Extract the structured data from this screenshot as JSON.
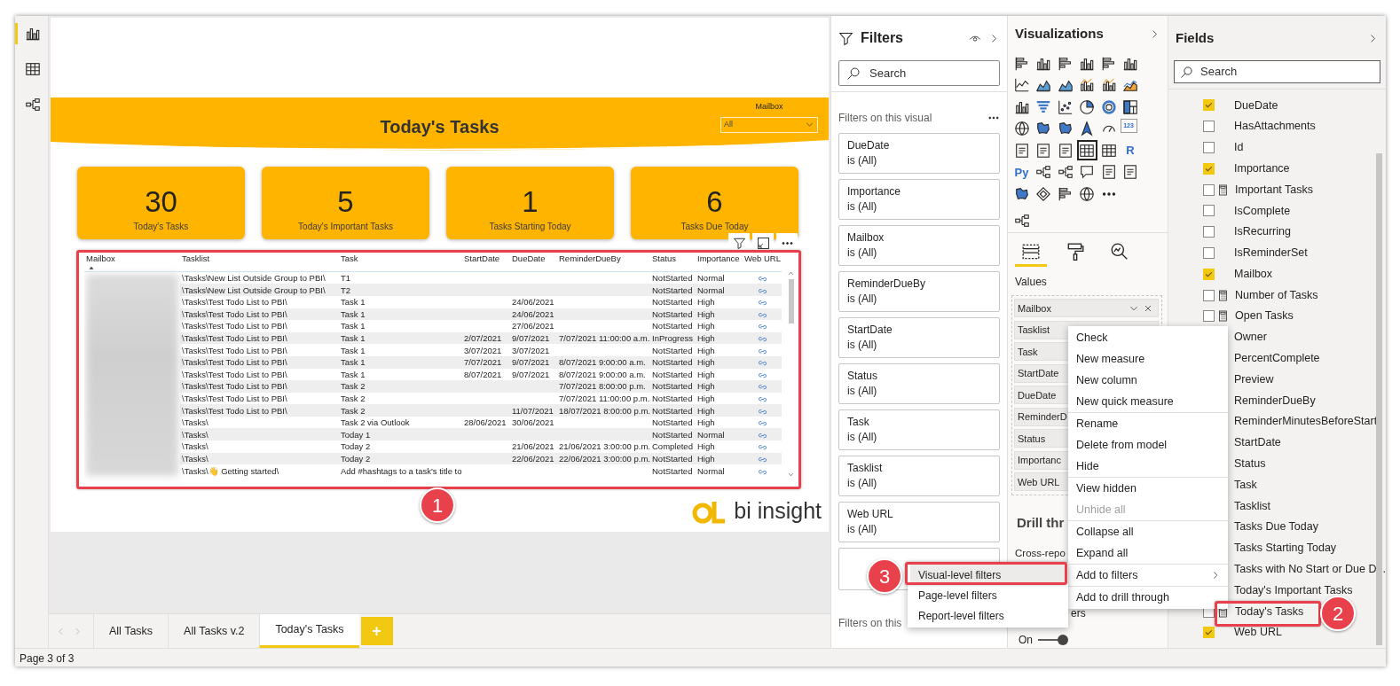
{
  "left_rail": [
    {
      "kind": "report",
      "selected": true
    },
    {
      "kind": "data",
      "selected": false
    },
    {
      "kind": "model",
      "selected": false
    }
  ],
  "report": {
    "title": "Today's Tasks",
    "slicer": {
      "label": "Mailbox",
      "value": "All"
    },
    "kpis": [
      {
        "value": "30",
        "label": "Today's Tasks"
      },
      {
        "value": "5",
        "label": "Today's Important Tasks"
      },
      {
        "value": "1",
        "label": "Tasks Starting Today"
      },
      {
        "value": "6",
        "label": "Tasks Due Today"
      }
    ],
    "table": {
      "columns": [
        {
          "label": "Mailbox",
          "sorted": true
        },
        {
          "label": "Tasklist",
          "sorted": false
        },
        {
          "label": "Task",
          "sorted": false
        },
        {
          "label": "StartDate",
          "sorted": false
        },
        {
          "label": "DueDate",
          "sorted": false
        },
        {
          "label": "ReminderDueBy",
          "sorted": false
        },
        {
          "label": "Status",
          "sorted": false
        },
        {
          "label": "Importance",
          "sorted": false
        },
        {
          "label": "Web URL",
          "sorted": false
        }
      ],
      "rows": [
        {
          "tasklist": "\\Tasks\\New List Outside Group to PBI\\",
          "task": "T1",
          "status": "NotStarted",
          "importance": "Normal"
        },
        {
          "tasklist": "\\Tasks\\New List Outside Group to PBI\\",
          "task": "T2",
          "status": "NotStarted",
          "importance": "Normal"
        },
        {
          "tasklist": "\\Tasks\\Test Todo List to PBI\\",
          "task": "Task 1",
          "due_date": "24/06/2021",
          "status": "NotStarted",
          "importance": "High"
        },
        {
          "tasklist": "\\Tasks\\Test Todo List to PBI\\",
          "task": "Task 1",
          "due_date": "24/06/2021",
          "status": "NotStarted",
          "importance": "High"
        },
        {
          "tasklist": "\\Tasks\\Test Todo List to PBI\\",
          "task": "Task 1",
          "due_date": "27/06/2021",
          "status": "NotStarted",
          "importance": "High"
        },
        {
          "tasklist": "\\Tasks\\Test Todo List to PBI\\",
          "task": "Task 1",
          "start_date": "2/07/2021",
          "due_date": "9/07/2021",
          "reminder_due_by": "7/07/2021 11:00:00 a.m.",
          "status": "InProgress",
          "importance": "High"
        },
        {
          "tasklist": "\\Tasks\\Test Todo List to PBI\\",
          "task": "Task 1",
          "start_date": "3/07/2021",
          "due_date": "3/07/2021",
          "status": "NotStarted",
          "importance": "High"
        },
        {
          "tasklist": "\\Tasks\\Test Todo List to PBI\\",
          "task": "Task 1",
          "start_date": "7/07/2021",
          "due_date": "9/07/2021",
          "reminder_due_by": "8/07/2021 9:00:00 a.m.",
          "status": "NotStarted",
          "importance": "High"
        },
        {
          "tasklist": "\\Tasks\\Test Todo List to PBI\\",
          "task": "Task 1",
          "start_date": "8/07/2021",
          "due_date": "9/07/2021",
          "reminder_due_by": "8/07/2021 9:00:00 a.m.",
          "status": "NotStarted",
          "importance": "High"
        },
        {
          "tasklist": "\\Tasks\\Test Todo List to PBI\\",
          "task": "Task 2",
          "reminder_due_by": "7/07/2021 8:00:00 p.m.",
          "status": "NotStarted",
          "importance": "High"
        },
        {
          "tasklist": "\\Tasks\\Test Todo List to PBI\\",
          "task": "Task 2",
          "reminder_due_by": "7/07/2021 11:00:00 p.m.",
          "status": "NotStarted",
          "importance": "High"
        },
        {
          "tasklist": "\\Tasks\\Test Todo List to PBI\\",
          "task": "Task 2",
          "due_date": "11/07/2021",
          "reminder_due_by": "18/07/2021 8:00:00 p.m.",
          "status": "NotStarted",
          "importance": "High"
        },
        {
          "tasklist": "\\Tasks\\",
          "task": "Task 2 via Outlook",
          "start_date": "28/06/2021",
          "due_date": "30/06/2021",
          "status": "NotStarted",
          "importance": "High"
        },
        {
          "tasklist": "\\Tasks\\",
          "task": "Today 1",
          "status": "NotStarted",
          "importance": "Normal"
        },
        {
          "tasklist": "\\Tasks\\",
          "task": "Today 2",
          "due_date": "21/06/2021",
          "reminder_due_by": "21/06/2021 3:00:00 p.m.",
          "status": "Completed",
          "importance": "High"
        },
        {
          "tasklist": "\\Tasks\\",
          "task": "Today 2",
          "due_date": "22/06/2021",
          "reminder_due_by": "22/06/2021 3:00:00 p.m.",
          "status": "NotStarted",
          "importance": "High"
        },
        {
          "tasklist": "\\Tasks\\👋 Getting started\\",
          "task": "Add #hashtags to a task's title to",
          "status": "NotStarted",
          "importance": "Normal"
        }
      ]
    },
    "logo": "bi insight"
  },
  "page_tabs": [
    {
      "label": "All Tasks",
      "selected": false
    },
    {
      "label": "All Tasks v.2",
      "selected": false
    },
    {
      "label": "Today's Tasks",
      "selected": true
    }
  ],
  "add_tab": "+",
  "status_bar": "Page 3 of 3",
  "filters": {
    "title": "Filters",
    "search_placeholder": "Search",
    "section": "Filters on this visual",
    "cards": [
      {
        "field": "DueDate",
        "condition": "is (All)"
      },
      {
        "field": "Importance",
        "condition": "is (All)"
      },
      {
        "field": "Mailbox",
        "condition": "is (All)"
      },
      {
        "field": "ReminderDueBy",
        "condition": "is (All)"
      },
      {
        "field": "StartDate",
        "condition": "is (All)"
      },
      {
        "field": "Status",
        "condition": "is (All)"
      },
      {
        "field": "Task",
        "condition": "is (All)"
      },
      {
        "field": "Tasklist",
        "condition": "is (All)"
      },
      {
        "field": "Web URL",
        "condition": "is (All)"
      }
    ],
    "next_section": "Filters on this"
  },
  "visualizations": {
    "title": "Visualizations",
    "icons": [
      {
        "kind": "hbar",
        "selected": false
      },
      {
        "kind": "column",
        "selected": false
      },
      {
        "kind": "hbar",
        "selected": false
      },
      {
        "kind": "column",
        "selected": false
      },
      {
        "kind": "hbar",
        "selected": false
      },
      {
        "kind": "column",
        "selected": false
      },
      {
        "kind": "line",
        "selected": false
      },
      {
        "kind": "area",
        "selected": false
      },
      {
        "kind": "area",
        "selected": false
      },
      {
        "kind": "linecol",
        "selected": false
      },
      {
        "kind": "linecol",
        "selected": false
      },
      {
        "kind": "ribbon",
        "selected": false
      },
      {
        "kind": "column",
        "selected": false
      },
      {
        "kind": "funnel",
        "selected": false
      },
      {
        "kind": "scatter",
        "selected": false
      },
      {
        "kind": "pie",
        "selected": false
      },
      {
        "kind": "donut",
        "selected": false
      },
      {
        "kind": "treemap",
        "selected": false
      },
      {
        "kind": "globe",
        "selected": false
      },
      {
        "kind": "map",
        "selected": false
      },
      {
        "kind": "map",
        "selected": false
      },
      {
        "kind": "arrow",
        "selected": false
      },
      {
        "kind": "gauge",
        "selected": false
      },
      {
        "kind": "text",
        "label": "123",
        "selected": false
      },
      {
        "kind": "doc",
        "selected": false
      },
      {
        "kind": "doc",
        "selected": false
      },
      {
        "kind": "doc",
        "selected": false
      },
      {
        "kind": "table",
        "selected": true
      },
      {
        "kind": "table",
        "selected": false
      },
      {
        "kind": "text",
        "label": "R",
        "selected": false
      },
      {
        "kind": "text",
        "label": "Py",
        "selected": false
      },
      {
        "kind": "tree",
        "selected": false
      },
      {
        "kind": "tree",
        "selected": false
      },
      {
        "kind": "bubble",
        "selected": false
      },
      {
        "kind": "doc",
        "selected": false
      },
      {
        "kind": "doc",
        "selected": false
      },
      {
        "kind": "map",
        "selected": false
      },
      {
        "kind": "diamond",
        "selected": false
      },
      {
        "kind": "hbar",
        "selected": false
      },
      {
        "kind": "globe",
        "selected": false
      },
      {
        "kind": "more",
        "selected": false
      },
      {
        "kind": "tree",
        "selected": false
      }
    ],
    "tabs": [
      {
        "kind": "fields",
        "selected": true
      },
      {
        "kind": "format",
        "selected": false
      },
      {
        "kind": "analytics",
        "selected": false
      }
    ],
    "values_label": "Values",
    "wells": [
      "Mailbox",
      "Tasklist",
      "Task",
      "StartDate",
      "DueDate",
      "ReminderD",
      "Status",
      "Importanc",
      "Web URL"
    ],
    "drill_title": "Drill thr",
    "cross_report": "Cross-repo",
    "keep_filters": "ers",
    "toggle": {
      "label": "On",
      "on": true
    }
  },
  "fields": {
    "title": "Fields",
    "search_placeholder": "Search",
    "items": [
      {
        "name": "DueDate",
        "checked": true,
        "kind": "column"
      },
      {
        "name": "HasAttachments",
        "checked": false,
        "kind": "column"
      },
      {
        "name": "Id",
        "checked": false,
        "kind": "column"
      },
      {
        "name": "Importance",
        "checked": true,
        "kind": "column"
      },
      {
        "name": "Important Tasks",
        "checked": false,
        "kind": "measure"
      },
      {
        "name": "IsComplete",
        "checked": false,
        "kind": "column"
      },
      {
        "name": "IsRecurring",
        "checked": false,
        "kind": "column"
      },
      {
        "name": "IsReminderSet",
        "checked": false,
        "kind": "column"
      },
      {
        "name": "Mailbox",
        "checked": true,
        "kind": "column"
      },
      {
        "name": "Number of Tasks",
        "checked": false,
        "kind": "measure"
      },
      {
        "name": "Open Tasks",
        "checked": false,
        "kind": "measure"
      },
      {
        "name": "Owner"
      },
      {
        "name": "PercentComplete"
      },
      {
        "name": "Preview"
      },
      {
        "name": "ReminderDueBy"
      },
      {
        "name": "ReminderMinutesBeforeStart"
      },
      {
        "name": "StartDate"
      },
      {
        "name": "Status"
      },
      {
        "name": "Task"
      },
      {
        "name": "Tasklist"
      },
      {
        "name": "Tasks Due Today"
      },
      {
        "name": "Tasks Starting Today"
      },
      {
        "name": "Tasks with No Start or Due D..."
      },
      {
        "name": "Today's Important Tasks"
      },
      {
        "name": "Today's Tasks",
        "checked": false,
        "kind": "measure"
      },
      {
        "name": "Web URL",
        "checked": true,
        "kind": "column"
      }
    ]
  },
  "context_menu": {
    "groups": [
      [
        {
          "label": "Check",
          "disabled": false,
          "submenu": false
        },
        {
          "label": "New measure",
          "disabled": false,
          "submenu": false
        },
        {
          "label": "New column",
          "disabled": false,
          "submenu": false
        },
        {
          "label": "New quick measure",
          "disabled": false,
          "submenu": false
        }
      ],
      [
        {
          "label": "Rename",
          "disabled": false,
          "submenu": false
        },
        {
          "label": "Delete from model",
          "disabled": false,
          "submenu": false
        },
        {
          "label": "Hide",
          "disabled": false,
          "submenu": false
        }
      ],
      [
        {
          "label": "View hidden",
          "disabled": false,
          "submenu": false
        },
        {
          "label": "Unhide all",
          "disabled": true,
          "submenu": false
        }
      ],
      [
        {
          "label": "Collapse all",
          "disabled": false,
          "submenu": false
        },
        {
          "label": "Expand all",
          "disabled": false,
          "submenu": false
        }
      ],
      [
        {
          "label": "Add to filters",
          "disabled": false,
          "submenu": true
        }
      ],
      [
        {
          "label": "Add to drill through",
          "disabled": false,
          "submenu": false
        }
      ]
    ]
  },
  "submenu": {
    "items": [
      {
        "label": "Visual-level filters",
        "selected": true
      },
      {
        "label": "Page-level filters",
        "selected": false
      },
      {
        "label": "Report-level filters",
        "selected": false
      }
    ]
  },
  "callouts": [
    {
      "number": "1"
    },
    {
      "number": "2"
    },
    {
      "number": "3"
    }
  ]
}
